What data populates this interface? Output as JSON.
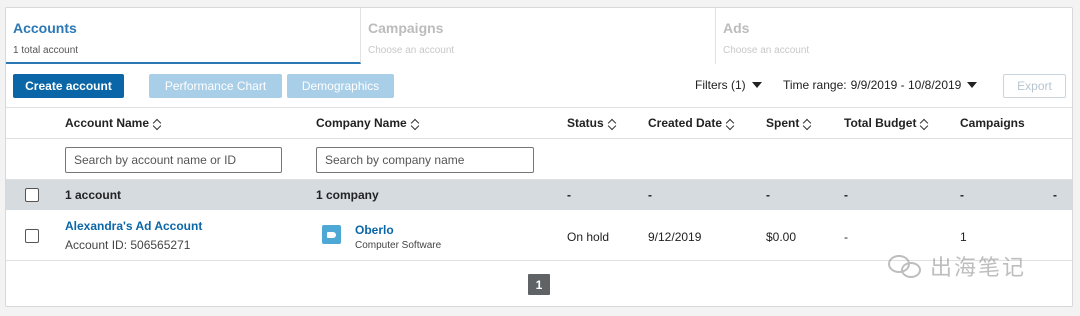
{
  "tabs": [
    {
      "title": "Accounts",
      "subtitle": "1 total account"
    },
    {
      "title": "Campaigns",
      "subtitle": "Choose an account"
    },
    {
      "title": "Ads",
      "subtitle": "Choose an account"
    }
  ],
  "toolbar": {
    "create_label": "Create account",
    "performance_label": "Performance Chart",
    "demographics_label": "Demographics",
    "filters_label": "Filters (1)",
    "time_range_label": "Time range:",
    "time_range_value": "9/9/2019 - 10/8/2019",
    "export_label": "Export"
  },
  "table": {
    "headers": [
      "Account Name",
      "Company Name",
      "Status",
      "Created Date",
      "Spent",
      "Total Budget",
      "Campaigns"
    ],
    "account_search_placeholder": "Search by account name or ID",
    "company_search_placeholder": "Search by company name",
    "summary": {
      "account": "1 account",
      "company": "1 company",
      "status": "-",
      "created": "-",
      "spent": "-",
      "budget": "-",
      "campaigns": "-",
      "extra": "-"
    },
    "rows": [
      {
        "account_name": "Alexandra's Ad Account",
        "account_id": "Account ID: 506565271",
        "company_name": "Oberlo",
        "company_industry": "Computer Software",
        "status": "On hold",
        "created": "9/12/2019",
        "spent": "$0.00",
        "budget": "-",
        "campaigns": "1"
      }
    ]
  },
  "pagination": {
    "current_page": "1"
  },
  "watermark": {
    "text": "出海笔记"
  },
  "colors": {
    "accent": "#2b78b5",
    "primary_button": "#0a66a6",
    "disabled_button": "#a9cee7",
    "summary_row": "#d6dbe0",
    "company_icon": "#4ea8d6"
  }
}
